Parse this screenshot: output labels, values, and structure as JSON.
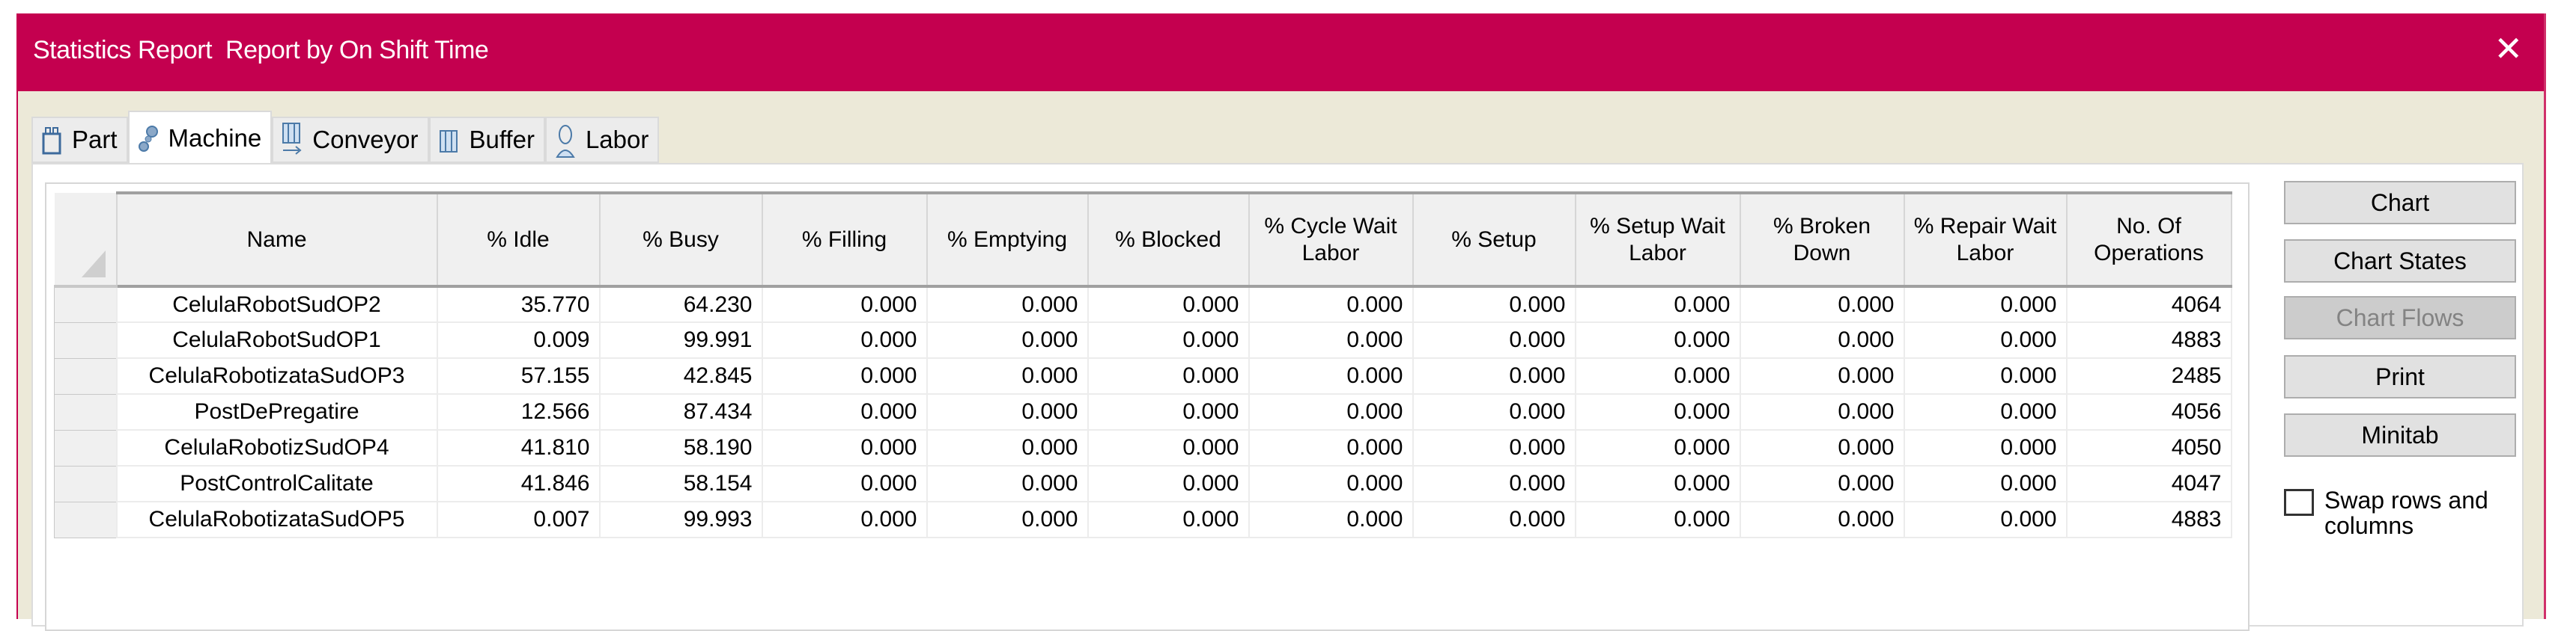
{
  "window": {
    "title": "Statistics Report",
    "subtitle": "Report by On Shift Time",
    "close_label": "✕",
    "accent": "#c4004f"
  },
  "tabs": [
    {
      "label": "Part",
      "icon": "part-icon"
    },
    {
      "label": "Machine",
      "icon": "machine-gears-icon",
      "active": true
    },
    {
      "label": "Conveyor",
      "icon": "conveyor-icon"
    },
    {
      "label": "Buffer",
      "icon": "buffer-icon"
    },
    {
      "label": "Labor",
      "icon": "labor-person-icon"
    }
  ],
  "table": {
    "columns": [
      "Name",
      "% Idle",
      "% Busy",
      "% Filling",
      "% Emptying",
      "% Blocked",
      "% Cycle Wait Labor",
      "% Setup",
      "% Setup Wait Labor",
      "% Broken Down",
      "% Repair Wait Labor",
      "No. Of Operations"
    ],
    "rows": [
      [
        "CelulaRobotSudOP2",
        "35.770",
        "64.230",
        "0.000",
        "0.000",
        "0.000",
        "0.000",
        "0.000",
        "0.000",
        "0.000",
        "0.000",
        "4064"
      ],
      [
        "CelulaRobotSudOP1",
        "0.009",
        "99.991",
        "0.000",
        "0.000",
        "0.000",
        "0.000",
        "0.000",
        "0.000",
        "0.000",
        "0.000",
        "4883"
      ],
      [
        "CelulaRobotizataSudOP3",
        "57.155",
        "42.845",
        "0.000",
        "0.000",
        "0.000",
        "0.000",
        "0.000",
        "0.000",
        "0.000",
        "0.000",
        "2485"
      ],
      [
        "PostDePregatire",
        "12.566",
        "87.434",
        "0.000",
        "0.000",
        "0.000",
        "0.000",
        "0.000",
        "0.000",
        "0.000",
        "0.000",
        "4056"
      ],
      [
        "CelulaRobotizSudOP4",
        "41.810",
        "58.190",
        "0.000",
        "0.000",
        "0.000",
        "0.000",
        "0.000",
        "0.000",
        "0.000",
        "0.000",
        "4050"
      ],
      [
        "PostControlCalitate",
        "41.846",
        "58.154",
        "0.000",
        "0.000",
        "0.000",
        "0.000",
        "0.000",
        "0.000",
        "0.000",
        "0.000",
        "4047"
      ],
      [
        "CelulaRobotizataSudOP5",
        "0.007",
        "99.993",
        "0.000",
        "0.000",
        "0.000",
        "0.000",
        "0.000",
        "0.000",
        "0.000",
        "0.000",
        "4883"
      ]
    ]
  },
  "buttons": {
    "chart": "Chart",
    "chart_states": "Chart States",
    "chart_flows": "Chart Flows",
    "print": "Print",
    "minitab": "Minitab"
  },
  "swap_checkbox": {
    "label": "Swap rows and columns",
    "checked": false
  }
}
